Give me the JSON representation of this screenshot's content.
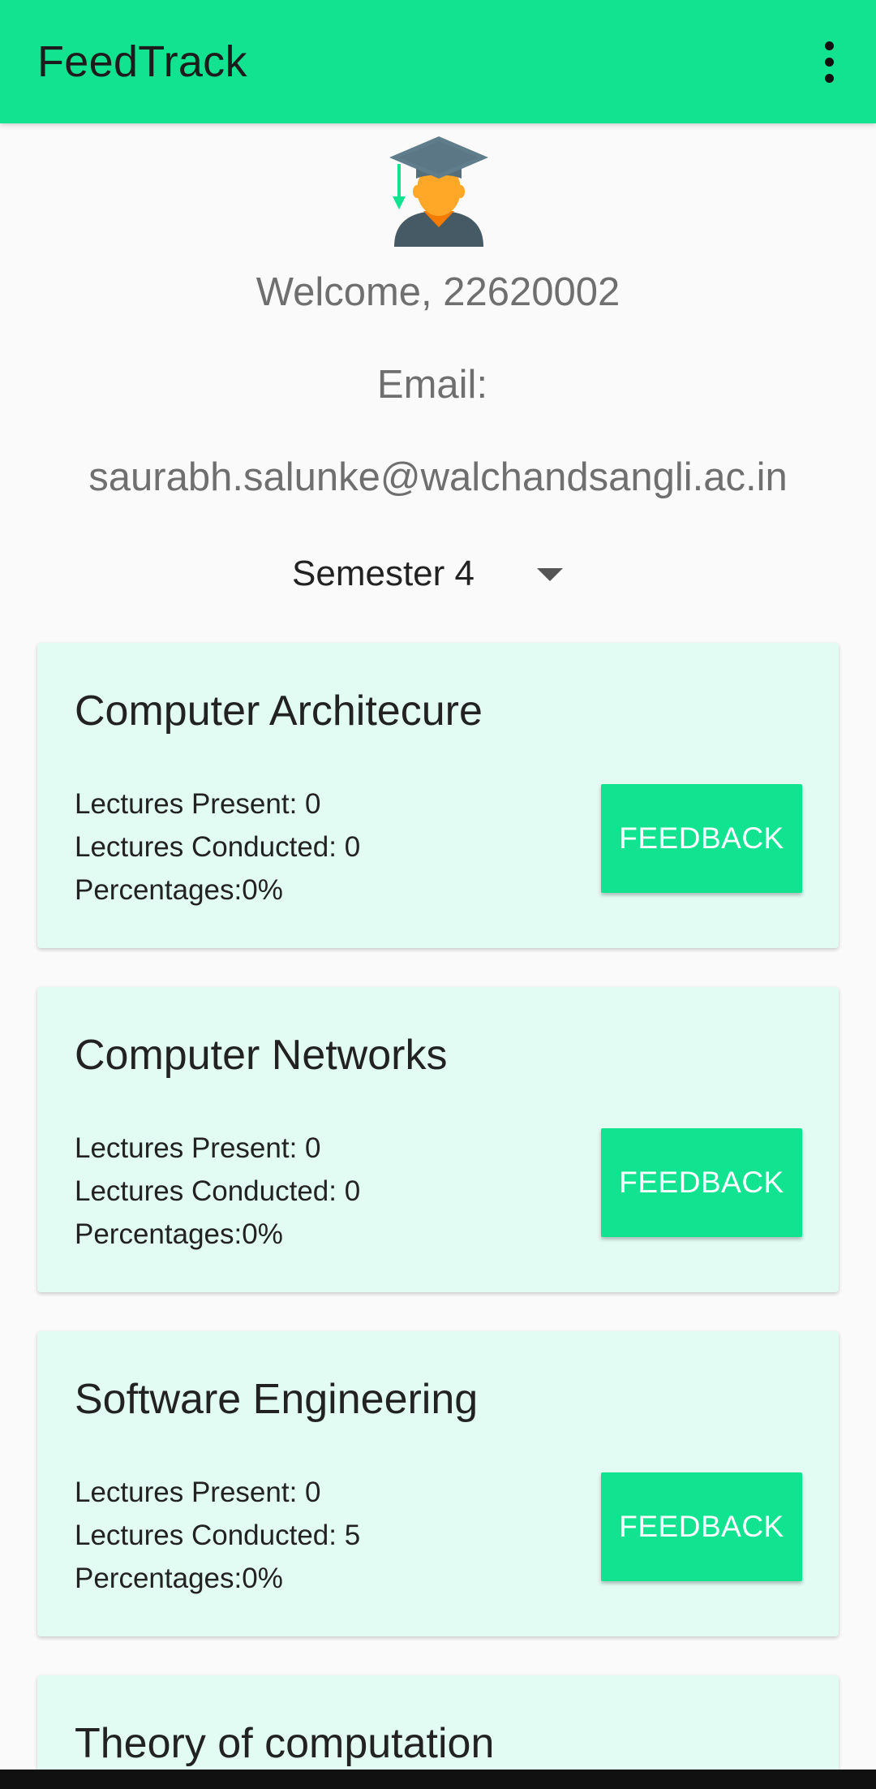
{
  "appbar": {
    "title": "FeedTrack",
    "overflow_icon": "more-vert-icon"
  },
  "profile": {
    "avatar_icon": "graduate-student-icon",
    "welcome": "Welcome, 22620002",
    "email_label": "Email:",
    "email_value": "saurabh.salunke@walchandsangli.ac.in"
  },
  "semester_select": {
    "selected": "Semester 4"
  },
  "colors": {
    "accent": "#12e391",
    "card_bg": "#e2fcf4"
  },
  "courses": [
    {
      "title": "Computer Architecure",
      "present": "Lectures Present: 0",
      "conducted": "Lectures Conducted: 0",
      "percentage": "Percentages:0%",
      "button": "FEEDBACK"
    },
    {
      "title": "Computer Networks",
      "present": "Lectures Present: 0",
      "conducted": "Lectures Conducted: 0",
      "percentage": "Percentages:0%",
      "button": "FEEDBACK"
    },
    {
      "title": "Software Engineering",
      "present": "Lectures Present: 0",
      "conducted": "Lectures Conducted: 5",
      "percentage": "Percentages:0%",
      "button": "FEEDBACK"
    },
    {
      "title": "Theory of computation"
    }
  ]
}
